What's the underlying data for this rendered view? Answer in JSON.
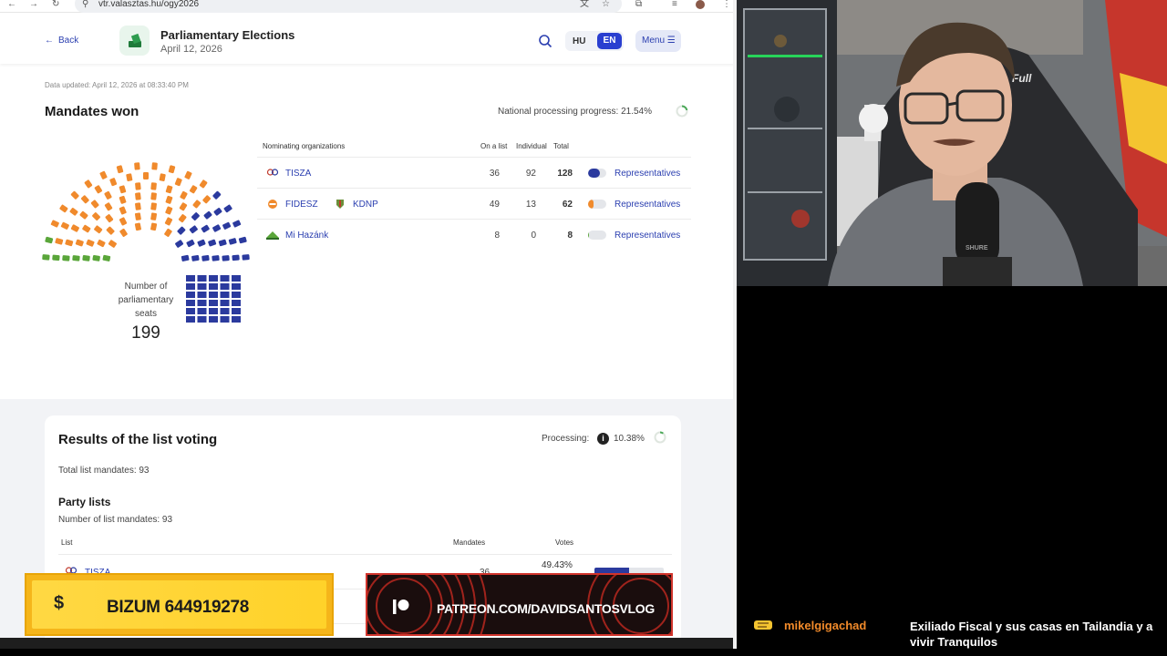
{
  "browser": {
    "url": "vtr.valasztas.hu/ogy2026"
  },
  "header": {
    "back_label": "Back",
    "title": "Parliamentary Elections",
    "date": "April 12, 2026",
    "lang_hu": "HU",
    "lang_en": "EN",
    "menu_label": "Menu",
    "menu_icon": "☰"
  },
  "mandates": {
    "updated": "Data updated: April 12, 2026 at 08:33:40 PM",
    "title": "Mandates won",
    "progress_label": "National processing progress:",
    "progress_value": "21.54%",
    "progress_fraction": 0.2154,
    "seats_label": "Number of parliamentary seats",
    "seats_total": "199",
    "table_headers": {
      "org": "Nominating organizations",
      "on_list": "On a list",
      "individual": "Individual",
      "total": "Total"
    },
    "rows": [
      {
        "name": "TISZA",
        "name2": "",
        "on_list": "36",
        "individual": "92",
        "total": "128",
        "link": "Representatives",
        "color": "#2b3a9e",
        "share": 0.64
      },
      {
        "name": "FIDESZ",
        "name2": "KDNP",
        "on_list": "49",
        "individual": "13",
        "total": "62",
        "link": "Representatives",
        "color": "#f08a2c",
        "share": 0.31
      },
      {
        "name": "Mi Hazánk",
        "name2": "",
        "on_list": "8",
        "individual": "0",
        "total": "8",
        "link": "Representatives",
        "color": "#5aa63a",
        "share": 0.04
      }
    ]
  },
  "list_voting": {
    "title": "Results of the list voting",
    "processing_label": "Processing:",
    "processing_value": "10.38%",
    "processing_fraction": 0.1038,
    "total_list": "Total list mandates: 93",
    "party_lists_title": "Party lists",
    "num_list": "Number of list mandates: 93",
    "headers": {
      "list": "List",
      "mandates": "Mandates",
      "votes": "Votes"
    },
    "rows": [
      {
        "name": "TISZA",
        "mandates": "36",
        "votes": "49.43%"
      }
    ]
  },
  "banners": {
    "bizum_symbol": "$",
    "bizum_text": "BIZUM 644919278",
    "patreon_text": "PATREON.COM/DAVIDSANTOSVLOG"
  },
  "chat": {
    "username": "mikelgigachad",
    "message": "Exiliado Fiscal y sus casas en Tailandia y a vivir Tranquilos"
  },
  "colors": {
    "tisza": "#2b3a9e",
    "fidesz": "#f08a2c",
    "mihazank": "#5aa63a",
    "accent": "#2a3fd0"
  }
}
